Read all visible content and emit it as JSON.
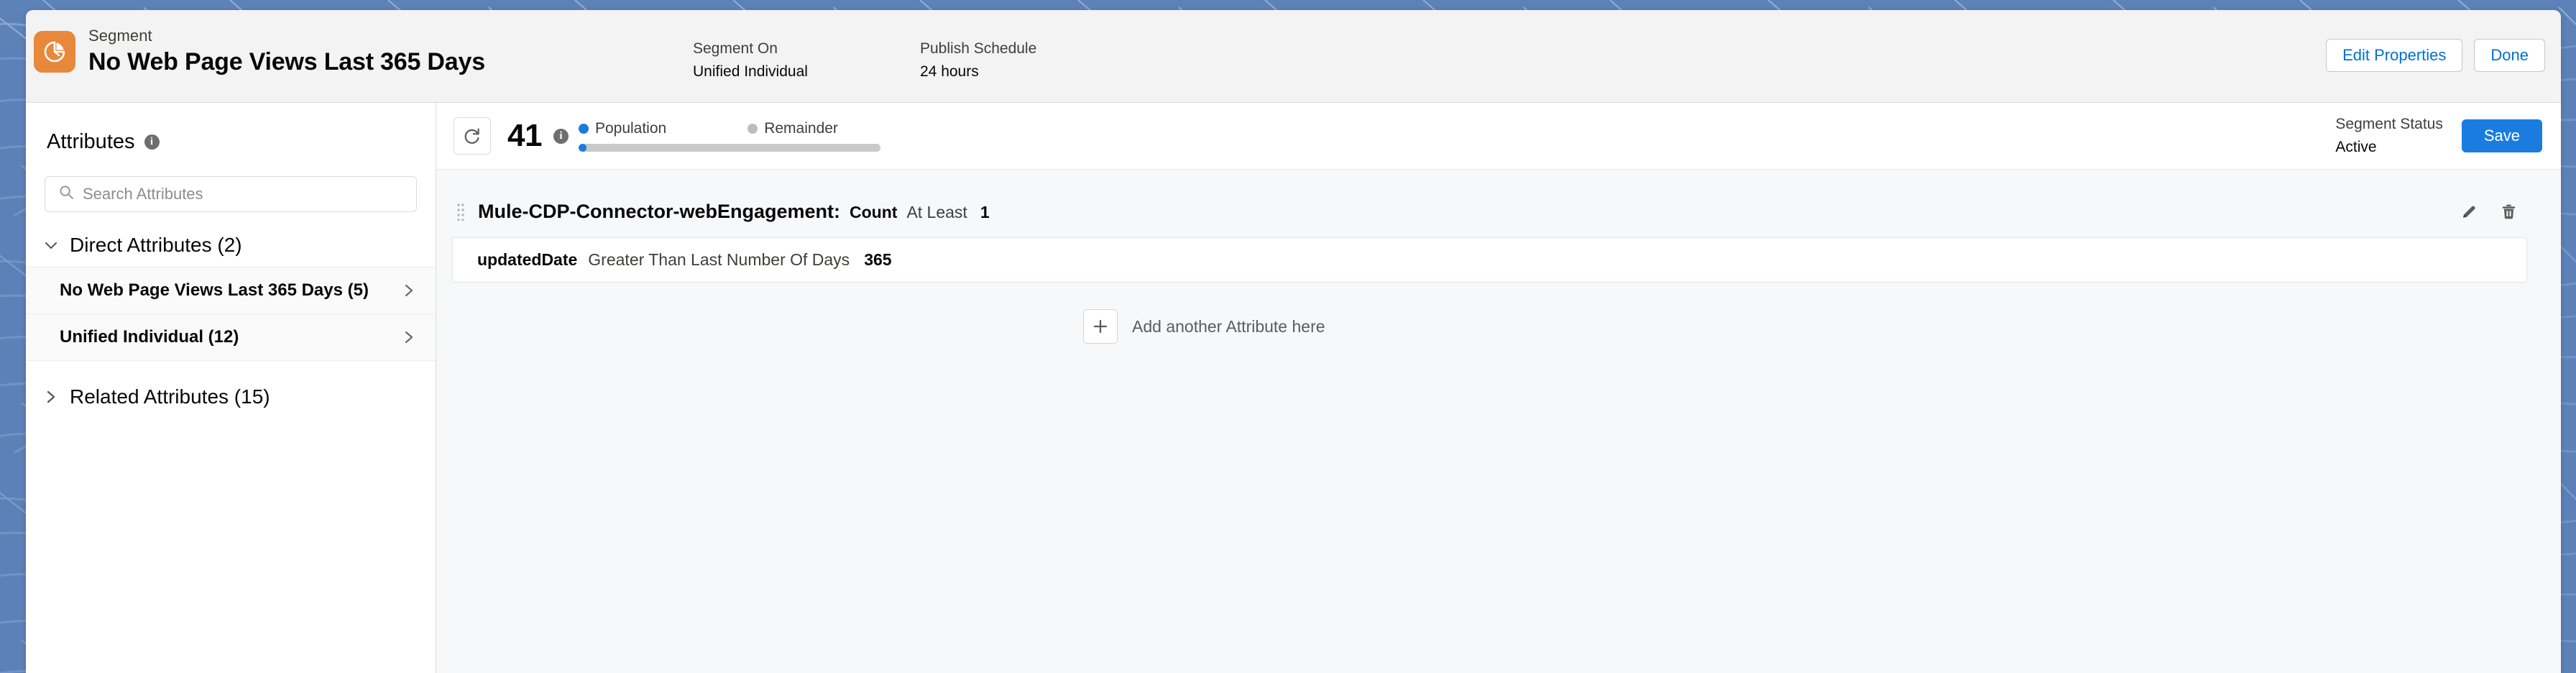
{
  "header": {
    "app_icon_name": "segment-pie-icon",
    "eyebrow": "Segment",
    "title": "No Web Page Views Last 365 Days",
    "fields": [
      {
        "label": "Segment On",
        "value": "Unified Individual"
      },
      {
        "label": "Publish Schedule",
        "value": "24 hours"
      }
    ],
    "actions": {
      "edit_properties_label": "Edit Properties",
      "done_label": "Done"
    }
  },
  "sidebar": {
    "heading": "Attributes",
    "heading_info_icon": "info-icon",
    "search": {
      "placeholder": "Search Attributes",
      "value": "",
      "icon": "search-icon"
    },
    "direct_section": {
      "label": "Direct Attributes (2)",
      "expanded": true,
      "chevron_icon": "chevron-down-icon",
      "items": [
        {
          "label": "No Web Page Views Last 365 Days (5)",
          "chevron_icon": "chevron-right-icon"
        },
        {
          "label": "Unified Individual (12)",
          "chevron_icon": "chevron-right-icon"
        }
      ]
    },
    "related_section": {
      "label": "Related Attributes (15)",
      "expanded": false,
      "chevron_icon": "chevron-right-icon"
    }
  },
  "toolbar": {
    "refresh_icon": "refresh-icon",
    "population_count": "41",
    "count_info_icon": "info-icon",
    "legend": {
      "population_label": "Population",
      "remainder_label": "Remainder",
      "population_color": "#1b7ce0",
      "remainder_color": "#bdbdbd"
    },
    "segment_status_label": "Segment Status",
    "segment_status_value": "Active",
    "save_label": "Save"
  },
  "rules": {
    "drag_handle_icon": "drag-handle-icon",
    "entity": "Mule-CDP-Connector-webEngagement:",
    "function": "Count",
    "operator": "At Least",
    "value": "1",
    "edit_icon": "pencil-icon",
    "delete_icon": "trash-icon",
    "condition": {
      "field": "updatedDate",
      "operator": "Greater Than Last Number Of Days",
      "value": "365"
    },
    "add_attribute_label": "Add another Attribute here",
    "add_attribute_icon": "plus-icon"
  },
  "colors": {
    "brand_orange": "#e8883a",
    "accent_blue": "#1b7ce0",
    "link_blue": "#0070d2",
    "desktop_background": "#5d82b8"
  }
}
